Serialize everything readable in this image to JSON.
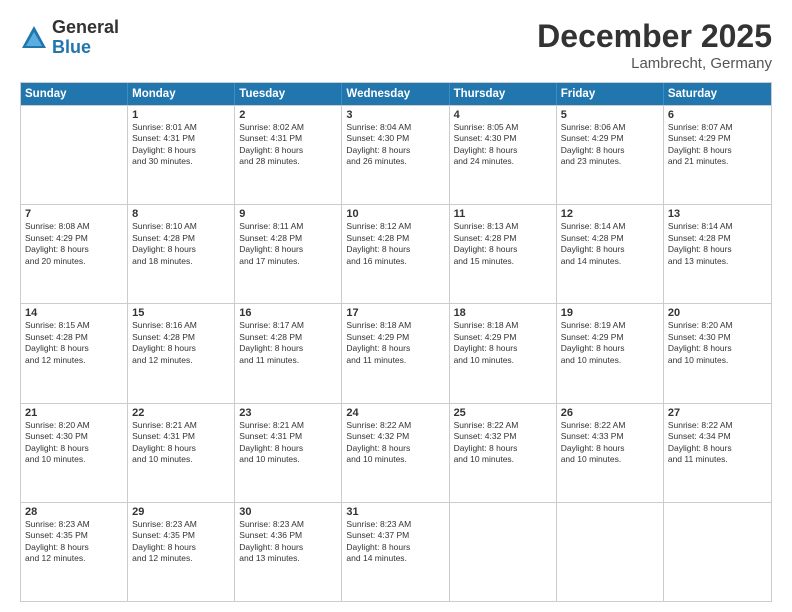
{
  "logo": {
    "general": "General",
    "blue": "Blue"
  },
  "title": {
    "month": "December 2025",
    "location": "Lambrecht, Germany"
  },
  "header": {
    "days": [
      "Sunday",
      "Monday",
      "Tuesday",
      "Wednesday",
      "Thursday",
      "Friday",
      "Saturday"
    ]
  },
  "rows": [
    [
      {
        "day": "",
        "sunrise": "",
        "sunset": "",
        "daylight": ""
      },
      {
        "day": "1",
        "sunrise": "Sunrise: 8:01 AM",
        "sunset": "Sunset: 4:31 PM",
        "daylight": "Daylight: 8 hours",
        "daylight2": "and 30 minutes."
      },
      {
        "day": "2",
        "sunrise": "Sunrise: 8:02 AM",
        "sunset": "Sunset: 4:31 PM",
        "daylight": "Daylight: 8 hours",
        "daylight2": "and 28 minutes."
      },
      {
        "day": "3",
        "sunrise": "Sunrise: 8:04 AM",
        "sunset": "Sunset: 4:30 PM",
        "daylight": "Daylight: 8 hours",
        "daylight2": "and 26 minutes."
      },
      {
        "day": "4",
        "sunrise": "Sunrise: 8:05 AM",
        "sunset": "Sunset: 4:30 PM",
        "daylight": "Daylight: 8 hours",
        "daylight2": "and 24 minutes."
      },
      {
        "day": "5",
        "sunrise": "Sunrise: 8:06 AM",
        "sunset": "Sunset: 4:29 PM",
        "daylight": "Daylight: 8 hours",
        "daylight2": "and 23 minutes."
      },
      {
        "day": "6",
        "sunrise": "Sunrise: 8:07 AM",
        "sunset": "Sunset: 4:29 PM",
        "daylight": "Daylight: 8 hours",
        "daylight2": "and 21 minutes."
      }
    ],
    [
      {
        "day": "7",
        "sunrise": "Sunrise: 8:08 AM",
        "sunset": "Sunset: 4:29 PM",
        "daylight": "Daylight: 8 hours",
        "daylight2": "and 20 minutes."
      },
      {
        "day": "8",
        "sunrise": "Sunrise: 8:10 AM",
        "sunset": "Sunset: 4:28 PM",
        "daylight": "Daylight: 8 hours",
        "daylight2": "and 18 minutes."
      },
      {
        "day": "9",
        "sunrise": "Sunrise: 8:11 AM",
        "sunset": "Sunset: 4:28 PM",
        "daylight": "Daylight: 8 hours",
        "daylight2": "and 17 minutes."
      },
      {
        "day": "10",
        "sunrise": "Sunrise: 8:12 AM",
        "sunset": "Sunset: 4:28 PM",
        "daylight": "Daylight: 8 hours",
        "daylight2": "and 16 minutes."
      },
      {
        "day": "11",
        "sunrise": "Sunrise: 8:13 AM",
        "sunset": "Sunset: 4:28 PM",
        "daylight": "Daylight: 8 hours",
        "daylight2": "and 15 minutes."
      },
      {
        "day": "12",
        "sunrise": "Sunrise: 8:14 AM",
        "sunset": "Sunset: 4:28 PM",
        "daylight": "Daylight: 8 hours",
        "daylight2": "and 14 minutes."
      },
      {
        "day": "13",
        "sunrise": "Sunrise: 8:14 AM",
        "sunset": "Sunset: 4:28 PM",
        "daylight": "Daylight: 8 hours",
        "daylight2": "and 13 minutes."
      }
    ],
    [
      {
        "day": "14",
        "sunrise": "Sunrise: 8:15 AM",
        "sunset": "Sunset: 4:28 PM",
        "daylight": "Daylight: 8 hours",
        "daylight2": "and 12 minutes."
      },
      {
        "day": "15",
        "sunrise": "Sunrise: 8:16 AM",
        "sunset": "Sunset: 4:28 PM",
        "daylight": "Daylight: 8 hours",
        "daylight2": "and 12 minutes."
      },
      {
        "day": "16",
        "sunrise": "Sunrise: 8:17 AM",
        "sunset": "Sunset: 4:28 PM",
        "daylight": "Daylight: 8 hours",
        "daylight2": "and 11 minutes."
      },
      {
        "day": "17",
        "sunrise": "Sunrise: 8:18 AM",
        "sunset": "Sunset: 4:29 PM",
        "daylight": "Daylight: 8 hours",
        "daylight2": "and 11 minutes."
      },
      {
        "day": "18",
        "sunrise": "Sunrise: 8:18 AM",
        "sunset": "Sunset: 4:29 PM",
        "daylight": "Daylight: 8 hours",
        "daylight2": "and 10 minutes."
      },
      {
        "day": "19",
        "sunrise": "Sunrise: 8:19 AM",
        "sunset": "Sunset: 4:29 PM",
        "daylight": "Daylight: 8 hours",
        "daylight2": "and 10 minutes."
      },
      {
        "day": "20",
        "sunrise": "Sunrise: 8:20 AM",
        "sunset": "Sunset: 4:30 PM",
        "daylight": "Daylight: 8 hours",
        "daylight2": "and 10 minutes."
      }
    ],
    [
      {
        "day": "21",
        "sunrise": "Sunrise: 8:20 AM",
        "sunset": "Sunset: 4:30 PM",
        "daylight": "Daylight: 8 hours",
        "daylight2": "and 10 minutes."
      },
      {
        "day": "22",
        "sunrise": "Sunrise: 8:21 AM",
        "sunset": "Sunset: 4:31 PM",
        "daylight": "Daylight: 8 hours",
        "daylight2": "and 10 minutes."
      },
      {
        "day": "23",
        "sunrise": "Sunrise: 8:21 AM",
        "sunset": "Sunset: 4:31 PM",
        "daylight": "Daylight: 8 hours",
        "daylight2": "and 10 minutes."
      },
      {
        "day": "24",
        "sunrise": "Sunrise: 8:22 AM",
        "sunset": "Sunset: 4:32 PM",
        "daylight": "Daylight: 8 hours",
        "daylight2": "and 10 minutes."
      },
      {
        "day": "25",
        "sunrise": "Sunrise: 8:22 AM",
        "sunset": "Sunset: 4:32 PM",
        "daylight": "Daylight: 8 hours",
        "daylight2": "and 10 minutes."
      },
      {
        "day": "26",
        "sunrise": "Sunrise: 8:22 AM",
        "sunset": "Sunset: 4:33 PM",
        "daylight": "Daylight: 8 hours",
        "daylight2": "and 10 minutes."
      },
      {
        "day": "27",
        "sunrise": "Sunrise: 8:22 AM",
        "sunset": "Sunset: 4:34 PM",
        "daylight": "Daylight: 8 hours",
        "daylight2": "and 11 minutes."
      }
    ],
    [
      {
        "day": "28",
        "sunrise": "Sunrise: 8:23 AM",
        "sunset": "Sunset: 4:35 PM",
        "daylight": "Daylight: 8 hours",
        "daylight2": "and 12 minutes."
      },
      {
        "day": "29",
        "sunrise": "Sunrise: 8:23 AM",
        "sunset": "Sunset: 4:35 PM",
        "daylight": "Daylight: 8 hours",
        "daylight2": "and 12 minutes."
      },
      {
        "day": "30",
        "sunrise": "Sunrise: 8:23 AM",
        "sunset": "Sunset: 4:36 PM",
        "daylight": "Daylight: 8 hours",
        "daylight2": "and 13 minutes."
      },
      {
        "day": "31",
        "sunrise": "Sunrise: 8:23 AM",
        "sunset": "Sunset: 4:37 PM",
        "daylight": "Daylight: 8 hours",
        "daylight2": "and 14 minutes."
      },
      {
        "day": "",
        "sunrise": "",
        "sunset": "",
        "daylight": "",
        "daylight2": ""
      },
      {
        "day": "",
        "sunrise": "",
        "sunset": "",
        "daylight": "",
        "daylight2": ""
      },
      {
        "day": "",
        "sunrise": "",
        "sunset": "",
        "daylight": "",
        "daylight2": ""
      }
    ]
  ]
}
